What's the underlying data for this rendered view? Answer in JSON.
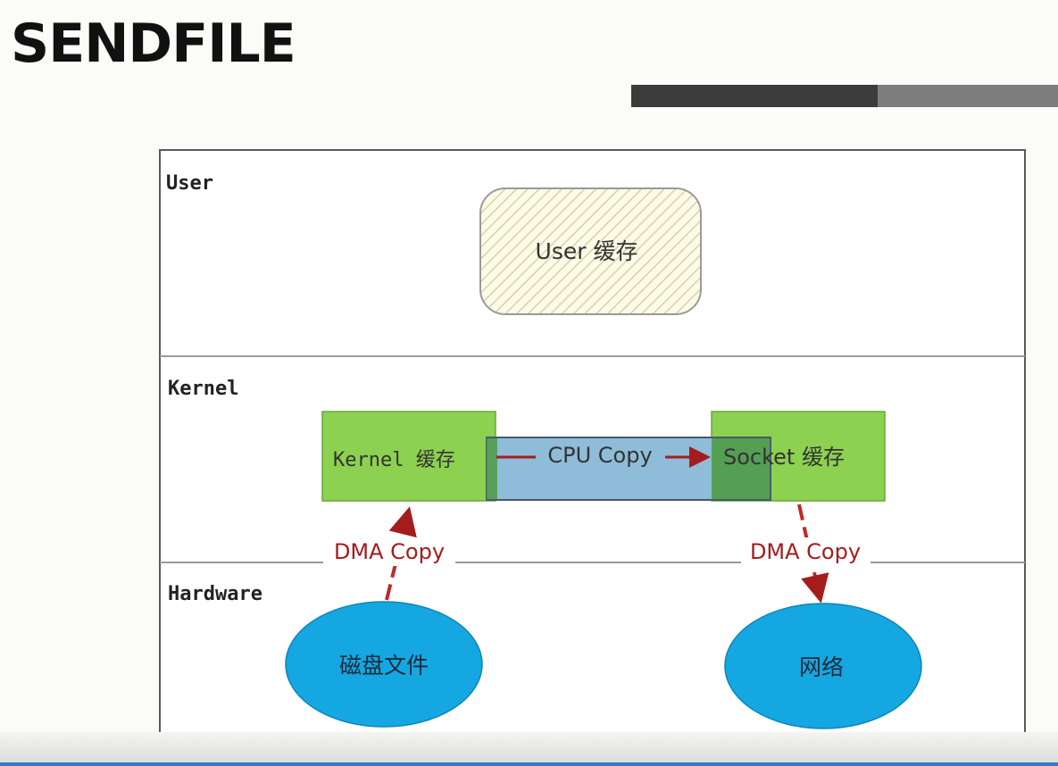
{
  "slide": {
    "title": "SENDFILE"
  },
  "layers": {
    "user": "User",
    "kernel": "Kernel",
    "hardware": "Hardware"
  },
  "boxes": {
    "user_cache": "User 缓存",
    "kernel_cache": "Kernel 缓存",
    "socket_cache": "Socket 缓存",
    "disk_file": "磁盘文件",
    "network": "网络"
  },
  "arrows": {
    "cpu_copy": "CPU Copy",
    "dma_copy_left": "DMA Copy",
    "dma_copy_right": "DMA Copy"
  },
  "colors": {
    "green_box": "#8cd150",
    "blue_ellipse": "#14a7e2",
    "selection_fill": "#8fbcd8",
    "arrow_red": "#a51c1c",
    "user_hatch": "#d6d4a6"
  }
}
